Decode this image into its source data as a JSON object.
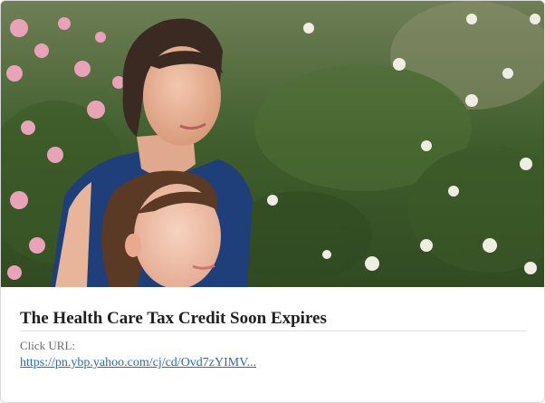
{
  "hero": {
    "image_alt": "Woman and girl in front of flowering shrubs"
  },
  "card": {
    "headline": "The Health Care Tax Credit Soon Expires",
    "url_label": "Click URL:",
    "url_text": "https://pn.ybp.yahoo.com/cj/cd/Ovd7zYIMV..."
  },
  "colors": {
    "link": "#2a6ab5",
    "headline": "#1f1f1f",
    "label": "#6b6b6b"
  }
}
